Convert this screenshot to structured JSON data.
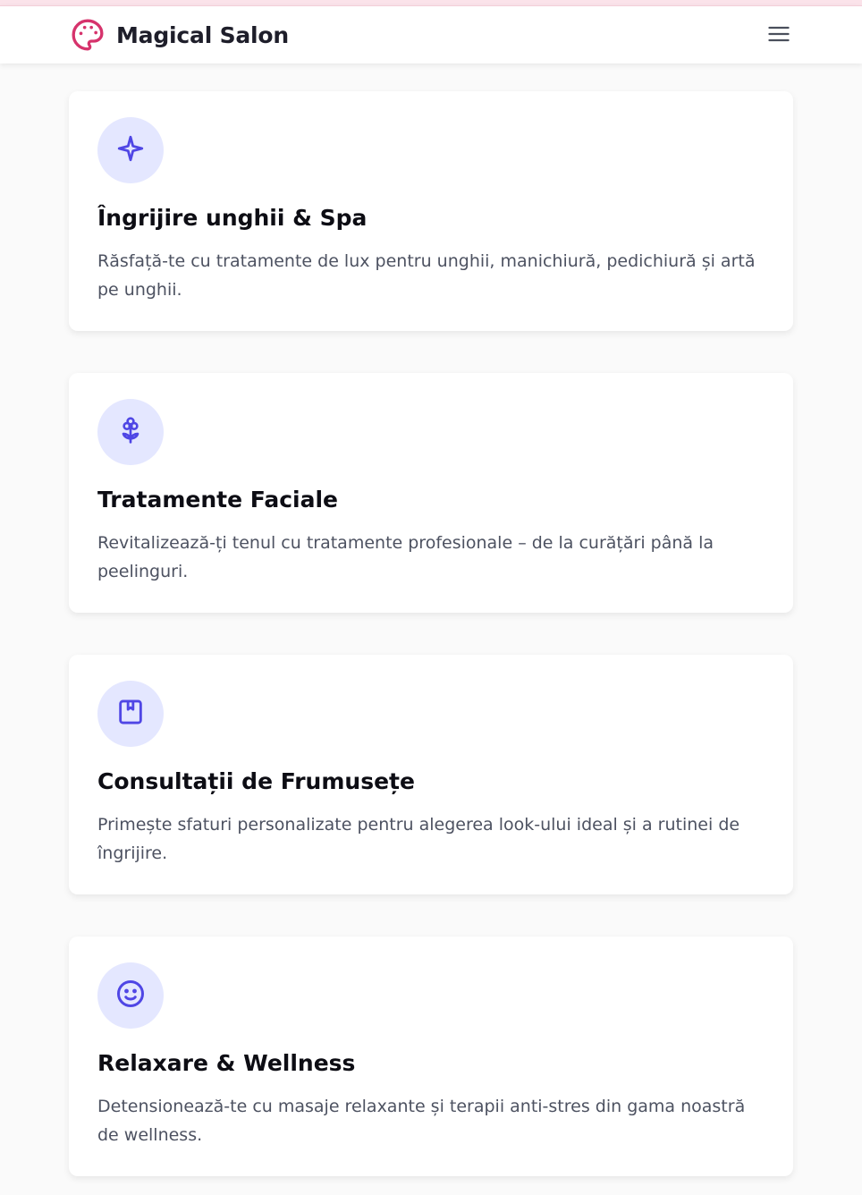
{
  "colors": {
    "brand_pink": "#d6336c",
    "accent_indigo": "#4f46e5",
    "icon_bg": "#e4e7ff"
  },
  "header": {
    "brand_name": "Magical Salon",
    "brand_icon": "palette-icon",
    "menu_icon": "hamburger-menu-icon"
  },
  "services": [
    {
      "icon": "sparkle-icon",
      "title": "Îngrijire unghii & Spa",
      "description": "Răsfață-te cu tratamente de lux pentru unghii, manichiură, pedichiură și artă pe unghii."
    },
    {
      "icon": "flower-icon",
      "title": "Tratamente Faciale",
      "description": "Revitalizează-ți tenul cu tratamente profesionale – de la curățări până la peelinguri."
    },
    {
      "icon": "bookmark-book-icon",
      "title": "Consultații de Frumusețe",
      "description": "Primește sfaturi personalizate pentru alegerea look-ului ideal și a rutinei de îngrijire."
    },
    {
      "icon": "smile-icon",
      "title": "Relaxare & Wellness",
      "description": "Detensionează-te cu masaje relaxante și terapii anti-stres din gama noastră de wellness."
    }
  ]
}
